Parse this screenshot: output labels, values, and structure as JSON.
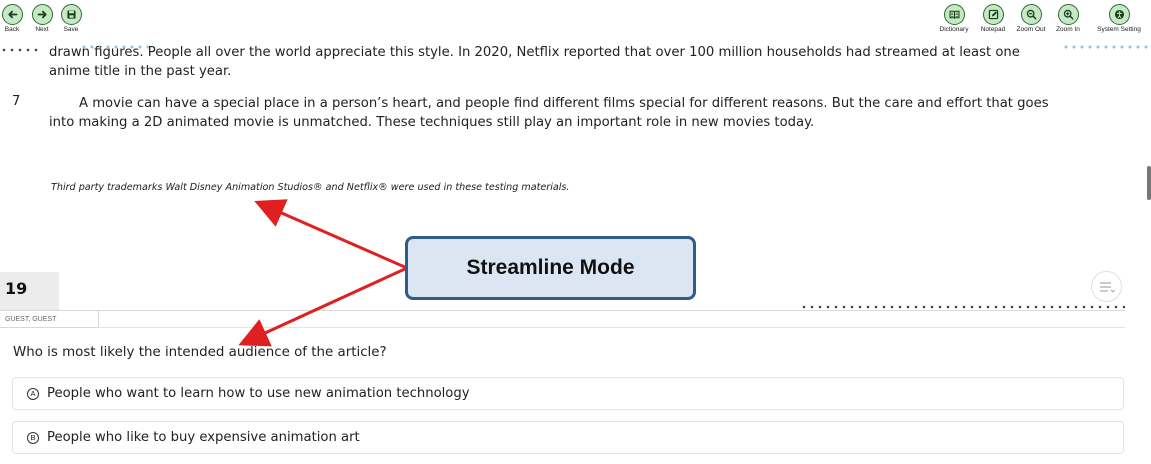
{
  "toolbar": {
    "left": [
      {
        "label": "Back",
        "icon": "arrow-left-icon"
      },
      {
        "label": "Next",
        "icon": "arrow-right-icon"
      },
      {
        "label": "Save",
        "icon": "save-icon"
      }
    ],
    "right": [
      {
        "label": "Dictionary",
        "icon": "book-icon"
      },
      {
        "label": "Notepad",
        "icon": "notepad-icon"
      },
      {
        "label": "Zoom Out",
        "icon": "zoom-out-icon"
      },
      {
        "label": "Zoom In",
        "icon": "zoom-in-icon"
      },
      {
        "label": "System Setting",
        "icon": "accessibility-icon"
      }
    ],
    "accent_color": "#2f6b2f",
    "button_fill": "#c5e8c5"
  },
  "passage": {
    "partial_line": "drawn figures. People all over the world appreciate this style. In 2020, Netflix reported that over 100 million households had streamed at least one",
    "line2": "anime title in the past year.",
    "para7_number": "7",
    "para7_line1": "A movie can have a special place in a person’s heart, and people find different films special for different reasons. But the care and effort that goes",
    "para7_line2": "into making a 2D animated movie is unmatched. These techniques still play an important role in new movies today.",
    "trademark": "Third party trademarks Walt Disney Animation Studios® and Netflix® were used in these testing materials."
  },
  "callout": {
    "label": "Streamline Mode",
    "border_color": "#2f5d8a",
    "fill_color": "#dce6f2",
    "arrow_color": "#e02020"
  },
  "question": {
    "number": "19",
    "user": "GUEST, GUEST",
    "prompt": "Who is most likely the intended audience of the article?",
    "options": [
      {
        "letter": "A",
        "text": "People who want to learn how to use new animation technology"
      },
      {
        "letter": "B",
        "text": "People who like to buy expensive animation art"
      }
    ]
  }
}
